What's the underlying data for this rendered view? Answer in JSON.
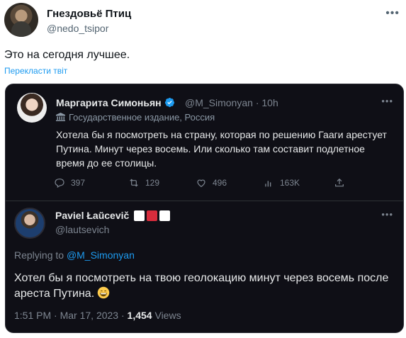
{
  "outer_tweet": {
    "author_name": "Гнездовьё Птиц",
    "author_handle": "@nedo_tsipor",
    "text": "Это на сегодня лучшее.",
    "translate_link": "Перекласти твіт",
    "more_icon": "more-horizontal-icon"
  },
  "screenshot": {
    "quoted_tweet": {
      "author_name": "Маргарита Симоньян",
      "verified_icon": "verified-badge-icon",
      "author_handle": "@M_Simonyan",
      "separator": "·",
      "time": "10h",
      "affiliation_label": "Государственное издание, Россия",
      "affiliation_icon": "government-building-icon",
      "text": "Хотела бы я посмотреть на страну, которая по решению Гааги арестует Путина. Минут через восемь. Или сколько там составит подлетное время до ее столицы.",
      "actions": {
        "replies": "397",
        "retweets": "129",
        "likes": "496",
        "views": "163K"
      }
    },
    "reply_tweet": {
      "author_name": "Paviel Łaŭcevič",
      "flag_icon": "white-red-white-flag-icon",
      "author_handle": "@lautsevich",
      "replying_prefix": "Replying to",
      "replying_to": "@M_Simonyan",
      "text": "Хотел бы я посмотреть на твою геолокацию минут через восемь после ареста Путина.",
      "emoji_icon": "grinning-face-emoji-icon",
      "time": "1:51 PM",
      "separator": "·",
      "date": "Mar 17, 2023",
      "views_count": "1,454",
      "views_label": "Views"
    }
  },
  "colors": {
    "link_blue": "#1d9bf0",
    "dark_background": "#0f0f16",
    "muted_text": "#7d8590",
    "flag_red": "#d72c3c"
  }
}
